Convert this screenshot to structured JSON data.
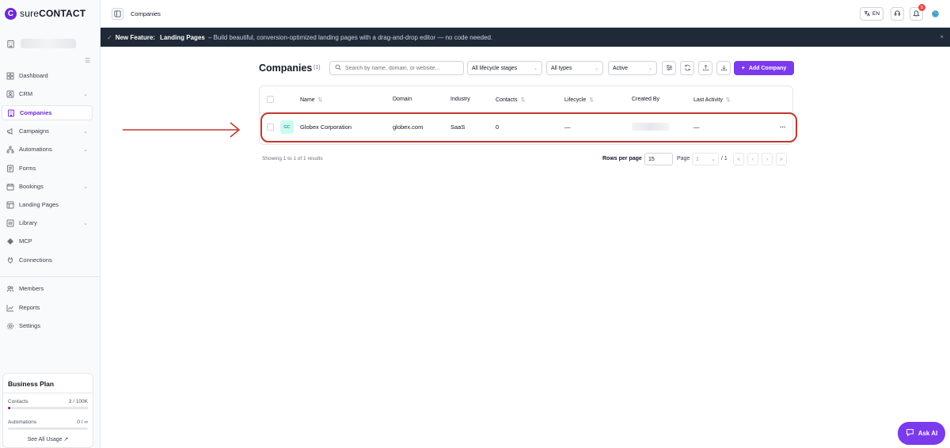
{
  "brand": {
    "mark": "C",
    "name_light": "sure",
    "name_bold": "CONTACT",
    "accent": "#7c3aed"
  },
  "sidebar": {
    "items": [
      {
        "label": "Dashboard",
        "icon": "dashboard-icon",
        "active": false
      },
      {
        "label": "CRM",
        "icon": "crm-icon",
        "active": false
      },
      {
        "label": "Companies",
        "icon": "building-icon",
        "active": true
      },
      {
        "label": "Campaigns",
        "icon": "megaphone-icon",
        "active": false
      },
      {
        "label": "Automations",
        "icon": "workflow-icon",
        "active": false
      },
      {
        "label": "Forms",
        "icon": "form-icon",
        "active": false
      },
      {
        "label": "Bookings",
        "icon": "calendar-icon",
        "active": false
      },
      {
        "label": "Landing Pages",
        "icon": "layout-icon",
        "active": false
      },
      {
        "label": "Library",
        "icon": "library-icon",
        "active": false
      },
      {
        "label": "MCP",
        "icon": "mcp-icon",
        "active": false
      },
      {
        "label": "Connections",
        "icon": "plug-icon",
        "active": false
      },
      {
        "label": "Members",
        "icon": "users-icon",
        "active": false
      },
      {
        "label": "Reports",
        "icon": "chart-icon",
        "active": false
      },
      {
        "label": "Settings",
        "icon": "gear-icon",
        "active": false
      }
    ],
    "plan": {
      "title": "Business Plan",
      "contacts_label": "Contacts",
      "contacts_value": "3 / 100K",
      "contacts_fill": 0.03,
      "automations_label": "Automations",
      "automations_value": "0 / ∞",
      "automations_fill": 0,
      "link": "See All Usage ↗"
    }
  },
  "topbar": {
    "title": "Companies",
    "lang": "EN",
    "notifications": "5"
  },
  "banner": {
    "lead": "New Feature:",
    "strong": "Landing Pages",
    "text": "– Build beautiful, conversion-optimized landing pages with a drag-and-drop editor — no code needed.",
    "close": "×"
  },
  "main": {
    "title": "Companies",
    "count": "(1)",
    "search_placeholder": "Search by name, domain, or website...",
    "filters": {
      "lifecycle": "All lifecycle stages",
      "type": "All types",
      "status": "Active"
    },
    "add_button": "Add Company",
    "columns": [
      "Name",
      "Domain",
      "Industry",
      "Contacts",
      "Lifecycle",
      "Created By",
      "Last Activity"
    ],
    "rows": [
      {
        "initials": "GC",
        "name": "Globex Corporation",
        "domain": "globex.com",
        "industry": "SaaS",
        "contacts": "0",
        "lifecycle": "—",
        "last_activity": "—",
        "actions": "···"
      }
    ],
    "footer": {
      "showing": "Showing 1 to 1 of 1 results",
      "rows_per_page_label": "Rows per page",
      "rows_per_page": "15",
      "page_label": "Page",
      "page_value": "1",
      "page_total": "/ 1"
    }
  },
  "ask_ai": "Ask AI"
}
